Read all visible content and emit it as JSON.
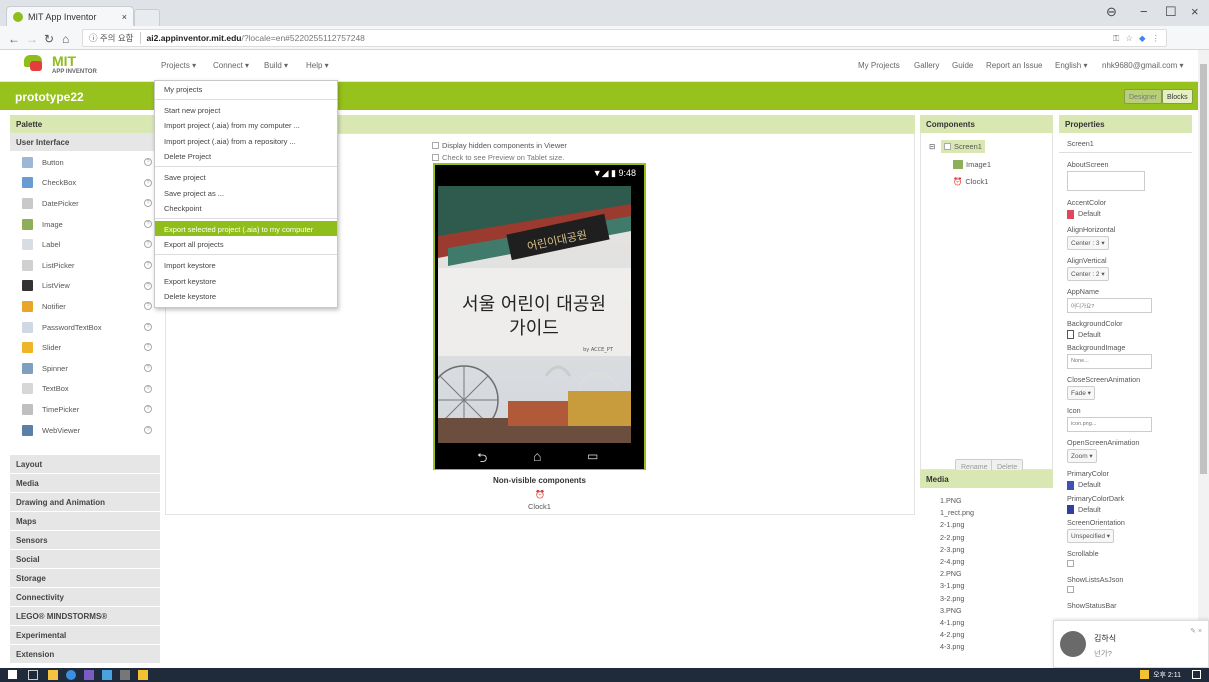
{
  "browser": {
    "tab_title": "MIT App Inventor",
    "tab_close": "×",
    "window_controls": [
      "⊖",
      "−",
      "☐",
      "×"
    ],
    "security_label": "ⓘ 주의 요함",
    "url_host": "ai2.appinventor.mit.edu",
    "url_path": "/?locale=en#5220255112757248"
  },
  "topnav": {
    "logo_main": "MIT",
    "logo_sub": "APP INVENTOR",
    "menus": [
      "Projects ▾",
      "Connect ▾",
      "Build ▾",
      "Help ▾"
    ],
    "right_links": [
      "My Projects",
      "Gallery",
      "Guide",
      "Report an Issue",
      "English ▾",
      "nhk9680@gmail.com ▾"
    ]
  },
  "project": {
    "name": "prototype22",
    "designer_btn": "Designer",
    "blocks_btn": "Blocks"
  },
  "projects_menu": {
    "groups": [
      [
        "My projects"
      ],
      [
        "Start new project",
        "Import project (.aia) from my computer ...",
        "Import project (.aia) from a repository ...",
        "Delete Project"
      ],
      [
        "Save project",
        "Save project as ...",
        "Checkpoint"
      ],
      [
        "Export selected project (.aia) to my computer",
        "Export all projects"
      ],
      [
        "Import keystore",
        "Export keystore",
        "Delete keystore"
      ]
    ],
    "highlighted": "Export selected project (.aia) to my computer"
  },
  "palette": {
    "title": "Palette",
    "open_section": "User Interface",
    "items": [
      {
        "label": "Button",
        "color": "#9db7d6"
      },
      {
        "label": "CheckBox",
        "color": "#6a9bd1"
      },
      {
        "label": "DatePicker",
        "color": "#c9c9c9"
      },
      {
        "label": "Image",
        "color": "#8fae5a"
      },
      {
        "label": "Label",
        "color": "#d8dde3"
      },
      {
        "label": "ListPicker",
        "color": "#d0d0d0"
      },
      {
        "label": "ListView",
        "color": "#333333"
      },
      {
        "label": "Notifier",
        "color": "#e8a52a"
      },
      {
        "label": "PasswordTextBox",
        "color": "#cfd8e3"
      },
      {
        "label": "Slider",
        "color": "#f0b429"
      },
      {
        "label": "Spinner",
        "color": "#7f9fbf"
      },
      {
        "label": "TextBox",
        "color": "#d7d7d7"
      },
      {
        "label": "TimePicker",
        "color": "#bfbfbf"
      },
      {
        "label": "WebViewer",
        "color": "#5c7fa8"
      }
    ],
    "help": "?",
    "sections": [
      "Layout",
      "Media",
      "Drawing and Animation",
      "Maps",
      "Sensors",
      "Social",
      "Storage",
      "Connectivity",
      "LEGO® MINDSTORMS®",
      "Experimental",
      "Extension"
    ]
  },
  "viewer": {
    "chk_hidden": "Display hidden components in Viewer",
    "chk_tablet": "Check to see Preview on Tablet size.",
    "phone_time": "▼◢ ▮ 9:48",
    "screen_title": "서울 어린이 대공원\n가이드",
    "sign_text": "어린이대공원",
    "credit": "by ACCE_PT",
    "nav_back": "⮌",
    "nav_home": "⌂",
    "nav_recent": "▭",
    "nonvisible_title": "Non-visible components",
    "nonvisible_icon": "⏰",
    "nonvisible_item": "Clock1"
  },
  "components": {
    "title": "Components",
    "tree_toggle": "⊟",
    "screen": "Screen1",
    "children": [
      {
        "label": "Image1",
        "icon": "image-icon"
      },
      {
        "label": "Clock1",
        "icon": "clock-icon"
      }
    ],
    "rename": "Rename",
    "delete": "Delete"
  },
  "media": {
    "title": "Media",
    "files": [
      "1.PNG",
      "1_rect.png",
      "2-1.png",
      "2-2.png",
      "2-3.png",
      "2-4.png",
      "2.PNG",
      "3-1.png",
      "3-2.png",
      "3.PNG",
      "4-1.png",
      "4-2.png",
      "4-3.png"
    ]
  },
  "properties": {
    "title": "Properties",
    "screen_name": "Screen1",
    "about_screen": "AboutScreen",
    "accent_color": "AccentColor",
    "accent_value": "Default",
    "accent_swatch": "#e0475f",
    "align_h": "AlignHorizontal",
    "align_h_value": "Center : 3 ▾",
    "align_v": "AlignVertical",
    "align_v_value": "Center : 2 ▾",
    "app_name": "AppName",
    "app_name_value": "어디가요?",
    "bg_color": "BackgroundColor",
    "bg_color_value": "Default",
    "bg_image": "BackgroundImage",
    "bg_image_value": "None...",
    "close_anim": "CloseScreenAnimation",
    "close_anim_value": "Fade ▾",
    "icon": "Icon",
    "icon_value": "icon.png...",
    "open_anim": "OpenScreenAnimation",
    "open_anim_value": "Zoom ▾",
    "primary_color": "PrimaryColor",
    "primary_value": "Default",
    "primary_swatch": "#3f51b5",
    "primary_dark": "PrimaryColorDark",
    "primary_dark_value": "Default",
    "primary_dark_swatch": "#303f9f",
    "orientation": "ScreenOrientation",
    "orientation_value": "Unspecified ▾",
    "scrollable": "Scrollable",
    "show_lists": "ShowListsAsJson",
    "show_status": "ShowStatusBar"
  },
  "notification": {
    "name": "김하식",
    "message": "넌가?",
    "controls": "✎ ×"
  },
  "taskbar": {
    "time": "오후 2:11"
  }
}
